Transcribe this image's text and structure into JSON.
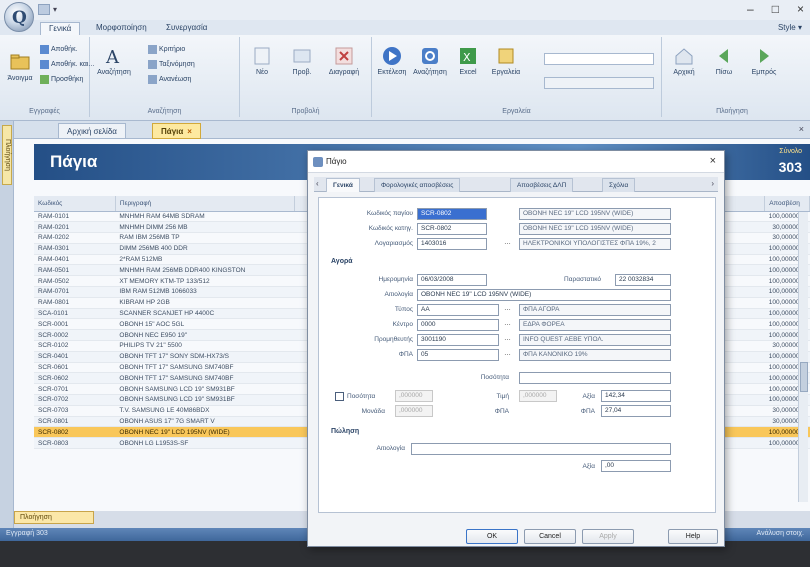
{
  "window": {
    "title": "",
    "minimize": "–",
    "maximize": "□",
    "close": "×"
  },
  "ribbon": {
    "tabs": [
      "Γενικά",
      "Μορφοποίηση",
      "Συνεργασία"
    ],
    "tab_right": "Style ▾",
    "groups": {
      "records": {
        "label": "Εγγραφές",
        "new": "Άνοιγμα",
        "save_small": [
          "Αποθήκ.",
          "Αποθήκ. και...",
          "Προσθήκη"
        ]
      },
      "search": {
        "label": "Αναζήτηση",
        "big": "Αναζήτηση",
        "small": [
          "Κριτήριο",
          "Ταξινόμηση",
          "Ανανέωση"
        ]
      },
      "view": {
        "label": "Προβολή",
        "items": [
          "Νέο",
          "Προβ.",
          "Διαγραφή"
        ]
      },
      "tools": {
        "label": "Εργαλεία",
        "items": [
          "Εκτέλεση",
          "Αναζήτηση",
          "Excel",
          "Εργαλεία"
        ]
      },
      "nav": {
        "label": "Πλοήγηση",
        "items": [
          "Αρχική",
          "Πίσω",
          "Εμπρός"
        ]
      }
    }
  },
  "left_strip": {
    "label": "Πλοήγηση"
  },
  "doc_tabs": {
    "home": "Αρχική σελίδα",
    "current": "Πάγια",
    "close": "×"
  },
  "banner": {
    "title": "Πάγια",
    "count_label": "Σύνολο",
    "count": "303"
  },
  "grid": {
    "headers": [
      "Κωδικός",
      "Περιγραφή",
      "Αποσβέση"
    ],
    "rows": [
      [
        "RAM-0101",
        "MNHMH RAM 64MB SDRAM",
        "100,00000"
      ],
      [
        "RAM-0201",
        "MNHMH DIMM 256 MB",
        "30,00000"
      ],
      [
        "RAM-0202",
        "RAM IBM 256MB TP",
        "30,00000"
      ],
      [
        "RAM-0301",
        "DIMM 256MB 400 DDR",
        "100,00000"
      ],
      [
        "RAM-0401",
        "2*RAM 512MB",
        "100,00000"
      ],
      [
        "RAM-0501",
        "MNHMH RAM 256MB DDR400 KINGSTON",
        "100,00000"
      ],
      [
        "RAM-0502",
        "XT MEMORY KTM-TP 133/512",
        "100,00000"
      ],
      [
        "RAM-0701",
        "IBM RAM 512MB 1066033",
        "100,00000"
      ],
      [
        "RAM-0801",
        "KIBRAM HP 2GB",
        "100,00000"
      ],
      [
        "SCA-0101",
        "SCANNER SCANJET HP 4400C",
        "100,00000"
      ],
      [
        "SCR-0001",
        "OBONH 15\" AOC 5GL",
        "100,00000"
      ],
      [
        "SCR-0002",
        "OBONH NEC E950 19\"",
        "100,00000"
      ],
      [
        "SCR-0102",
        "PHILIPS TV 21\" 5500",
        "30,00000"
      ],
      [
        "SCR-0401",
        "OBONH TFT 17\" SONY SDM-HX73/S",
        "100,00000"
      ],
      [
        "SCR-0601",
        "OBONH TFT 17\" SAMSUNG SM740BF",
        "100,00000"
      ],
      [
        "SCR-0602",
        "OBONH TFT 17\" SAMSUNG SM740BF",
        "100,00000"
      ],
      [
        "SCR-0701",
        "OBONH SAMSUNG LCD 19\" SM931BF",
        "100,00000"
      ],
      [
        "SCR-0702",
        "OBONH SAMSUNG LCD 19\" SM931BF",
        "100,00000"
      ],
      [
        "SCR-0703",
        "T.V. SAMSUNG LE 40M86BDX",
        "30,00000"
      ],
      [
        "SCR-0801",
        "OBONH ASUS 17\" 7G SMART V",
        "30,00000"
      ],
      [
        "SCR-0802",
        "OBONH NEC 19\" LCD 195NV (WIDE)",
        "100,00000"
      ],
      [
        "SCR-0803",
        "OBONH LG L1953S-SF",
        "100,00000"
      ]
    ],
    "selected_index": 20
  },
  "paging": "Πλοήγηση",
  "status": {
    "left": "Εγγραφή 303",
    "right": "Ανάλυση στοιχ."
  },
  "dialog": {
    "title": "Πάγιο",
    "close": "×",
    "tabs": [
      "Γενικά",
      "Φορολογικές αποσβέσεις",
      "Αποσβέσεις ΔΛΠ",
      "Σχόλια"
    ],
    "fields": {
      "code_label": "Κωδικός παγίου",
      "code_value": "SCR-0802",
      "code_desc": "OBONH NEC 19\" LCD 195NV (WIDE)",
      "main_code_label": "Κωδικός κατηγ.",
      "main_code_value": "SCR-0802",
      "main_code_desc": "OBONH NEC 19\" LCD 195NV (WIDE)",
      "category_label": "Λογαριασμός",
      "category_value": "1403016",
      "category_desc": "ΗΛΕΚΤΡΟΝΙΚΟΙ ΥΠΟΛΟΓΙΣΤΕΣ ΦΠΑ 19%, 2",
      "purchase_section": "Αγορά",
      "date_label": "Ημερομηνία",
      "date_value": "06/03/2008",
      "doc_label": "Παραστατικό",
      "doc_value": "22 0032834",
      "desc_label": "Αιτιολογία",
      "desc_value": "OBONH NEC 19\" LCD 195NV (WIDE)",
      "type_label": "Τύπος",
      "type_value": "ΑΑ",
      "type_desc": "ΦΠΑ ΑΓΟΡΑ",
      "branch_label": "Κέντρο",
      "branch_value": "0000",
      "branch_desc": "ΕΔΡΑ ΦΟΡΕΑ",
      "supplier_label": "Προμηθευτής",
      "supplier_value": "3001190",
      "supplier_desc": "INFO QUEST ΑΕΒΕ ΥΠΟΛ.",
      "vat_label": "ΦΠΑ",
      "vat_value": "05",
      "vat_desc": "ΦΠΑ ΚΑΝΟΝΙΚΟ 19%",
      "qty_label": "Ποσότητα",
      "qty_check_label": "Ποσότητα",
      "qty_value": ",000000",
      "price_label": "Τιμή",
      "price_value": ",000000",
      "unit_label": "Μονάδα",
      "unit_value": ",000000",
      "vat_amt_label": "ΦΠΑ",
      "value_label": "Αξία",
      "value_value": "142,34",
      "vat_total_label": "ΦΠΑ",
      "vat_total_value": "27,04",
      "sale_section": "Πώληση",
      "sale_desc_label": "Αιτιολογία",
      "sale_value_label": "Αξία",
      "sale_value_value": ",00"
    },
    "buttons": {
      "ok": "OK",
      "cancel": "Cancel",
      "apply": "Apply",
      "help": "Help"
    }
  }
}
